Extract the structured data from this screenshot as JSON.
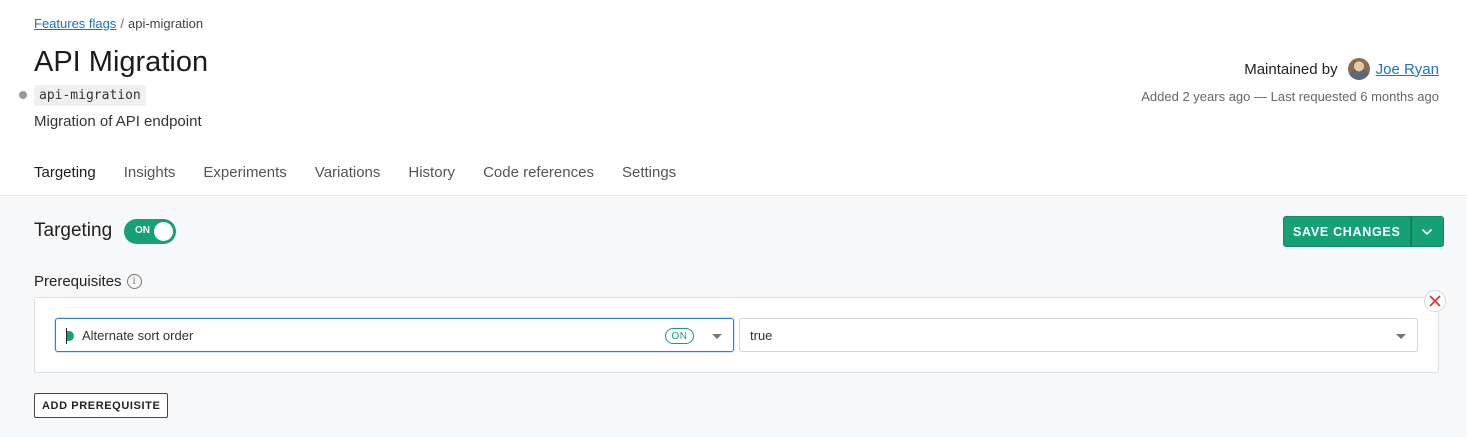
{
  "breadcrumb": {
    "parent": "Features flags",
    "separator": "/",
    "current": "api-migration"
  },
  "flag": {
    "title": "API Migration",
    "key": "api-migration",
    "description": "Migration of API endpoint"
  },
  "maintainer": {
    "label": "Maintained by",
    "name": "Joe Ryan"
  },
  "meta": {
    "added_info": "Added 2 years ago — Last requested 6 months ago"
  },
  "tabs": [
    {
      "label": "Targeting",
      "active": true
    },
    {
      "label": "Insights"
    },
    {
      "label": "Experiments"
    },
    {
      "label": "Variations"
    },
    {
      "label": "History"
    },
    {
      "label": "Code references"
    },
    {
      "label": "Settings"
    }
  ],
  "targeting": {
    "label": "Targeting",
    "toggle_label": "ON",
    "toggle_on": true
  },
  "actions": {
    "save_label": "SAVE CHANGES"
  },
  "prerequisites": {
    "label": "Prerequisites",
    "items": [
      {
        "flag_name": "Alternate sort order",
        "flag_status": "ON",
        "value": "true"
      }
    ],
    "add_label": "ADD PREREQUISITE"
  },
  "colors": {
    "accent": "#15a075",
    "link": "#1a73c6",
    "remove": "#d93b3b"
  }
}
